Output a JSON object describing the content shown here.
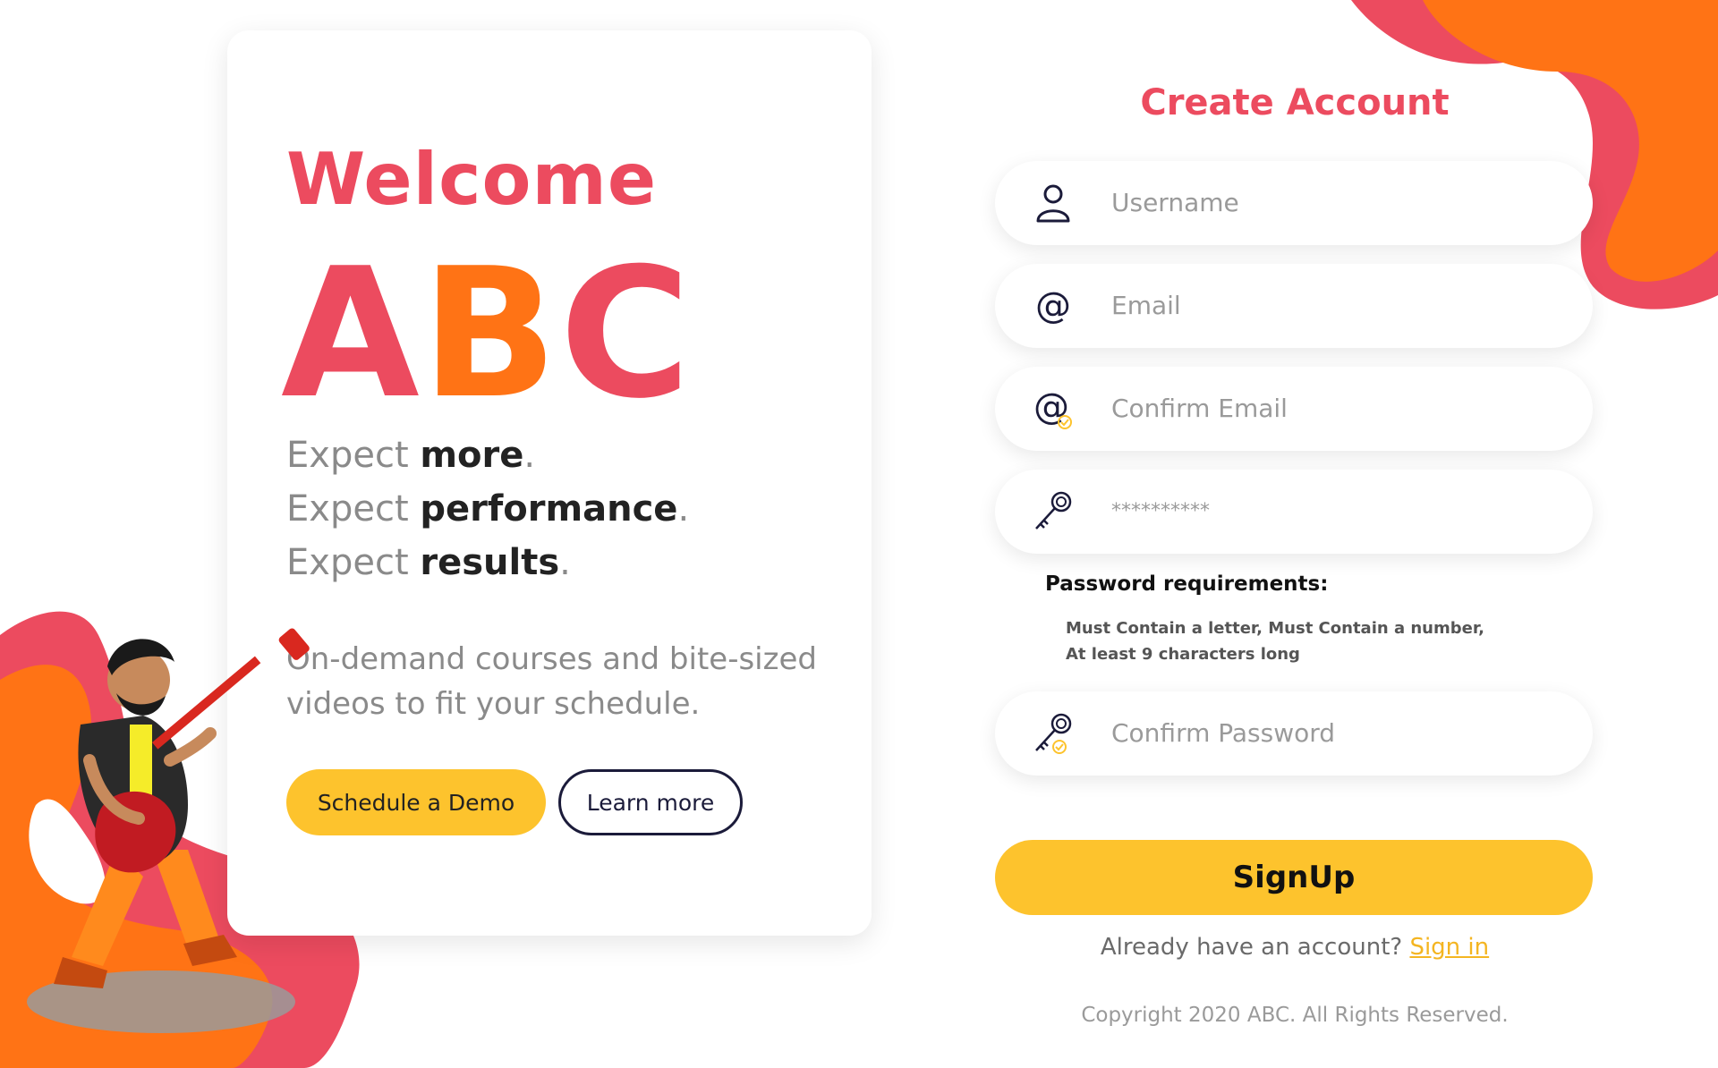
{
  "hero": {
    "welcome": "Welcome",
    "brand": {
      "part1": "A",
      "part2": "B",
      "part3": "C"
    },
    "expect_lines": [
      {
        "prefix": "Expect ",
        "strong": "more",
        "dot": "."
      },
      {
        "prefix": "Expect ",
        "strong": "performance",
        "dot": "."
      },
      {
        "prefix": "Expect ",
        "strong": "results",
        "dot": "."
      }
    ],
    "description": "On-demand courses and bite-sized videos to fit your schedule.",
    "demo_button": "Schedule a Demo",
    "learn_button": "Learn more"
  },
  "form": {
    "title": "Create Account",
    "username_placeholder": "Username",
    "email_placeholder": "Email",
    "confirm_email_placeholder": "Confirm Email",
    "password_value": "**********",
    "password_requirements_title": "Password requirements:",
    "password_requirements_line1": "Must Contain a letter, Must Contain a number,",
    "password_requirements_line2": "At least 9 characters long",
    "confirm_password_placeholder": "Confirm Password",
    "signup_label": "SignUp",
    "account_prompt": "Already have an account? ",
    "signin_link": "Sign in",
    "copyright": "Copyright 2020 ABC. All Rights Reserved."
  },
  "colors": {
    "primary_red": "#ec4b5f",
    "primary_orange": "#ff7315",
    "accent_yellow": "#fdc32d",
    "dark_navy": "#1b1b3a"
  },
  "icons": [
    "user-icon",
    "at-icon",
    "at-check-icon",
    "key-icon",
    "key-check-icon"
  ]
}
